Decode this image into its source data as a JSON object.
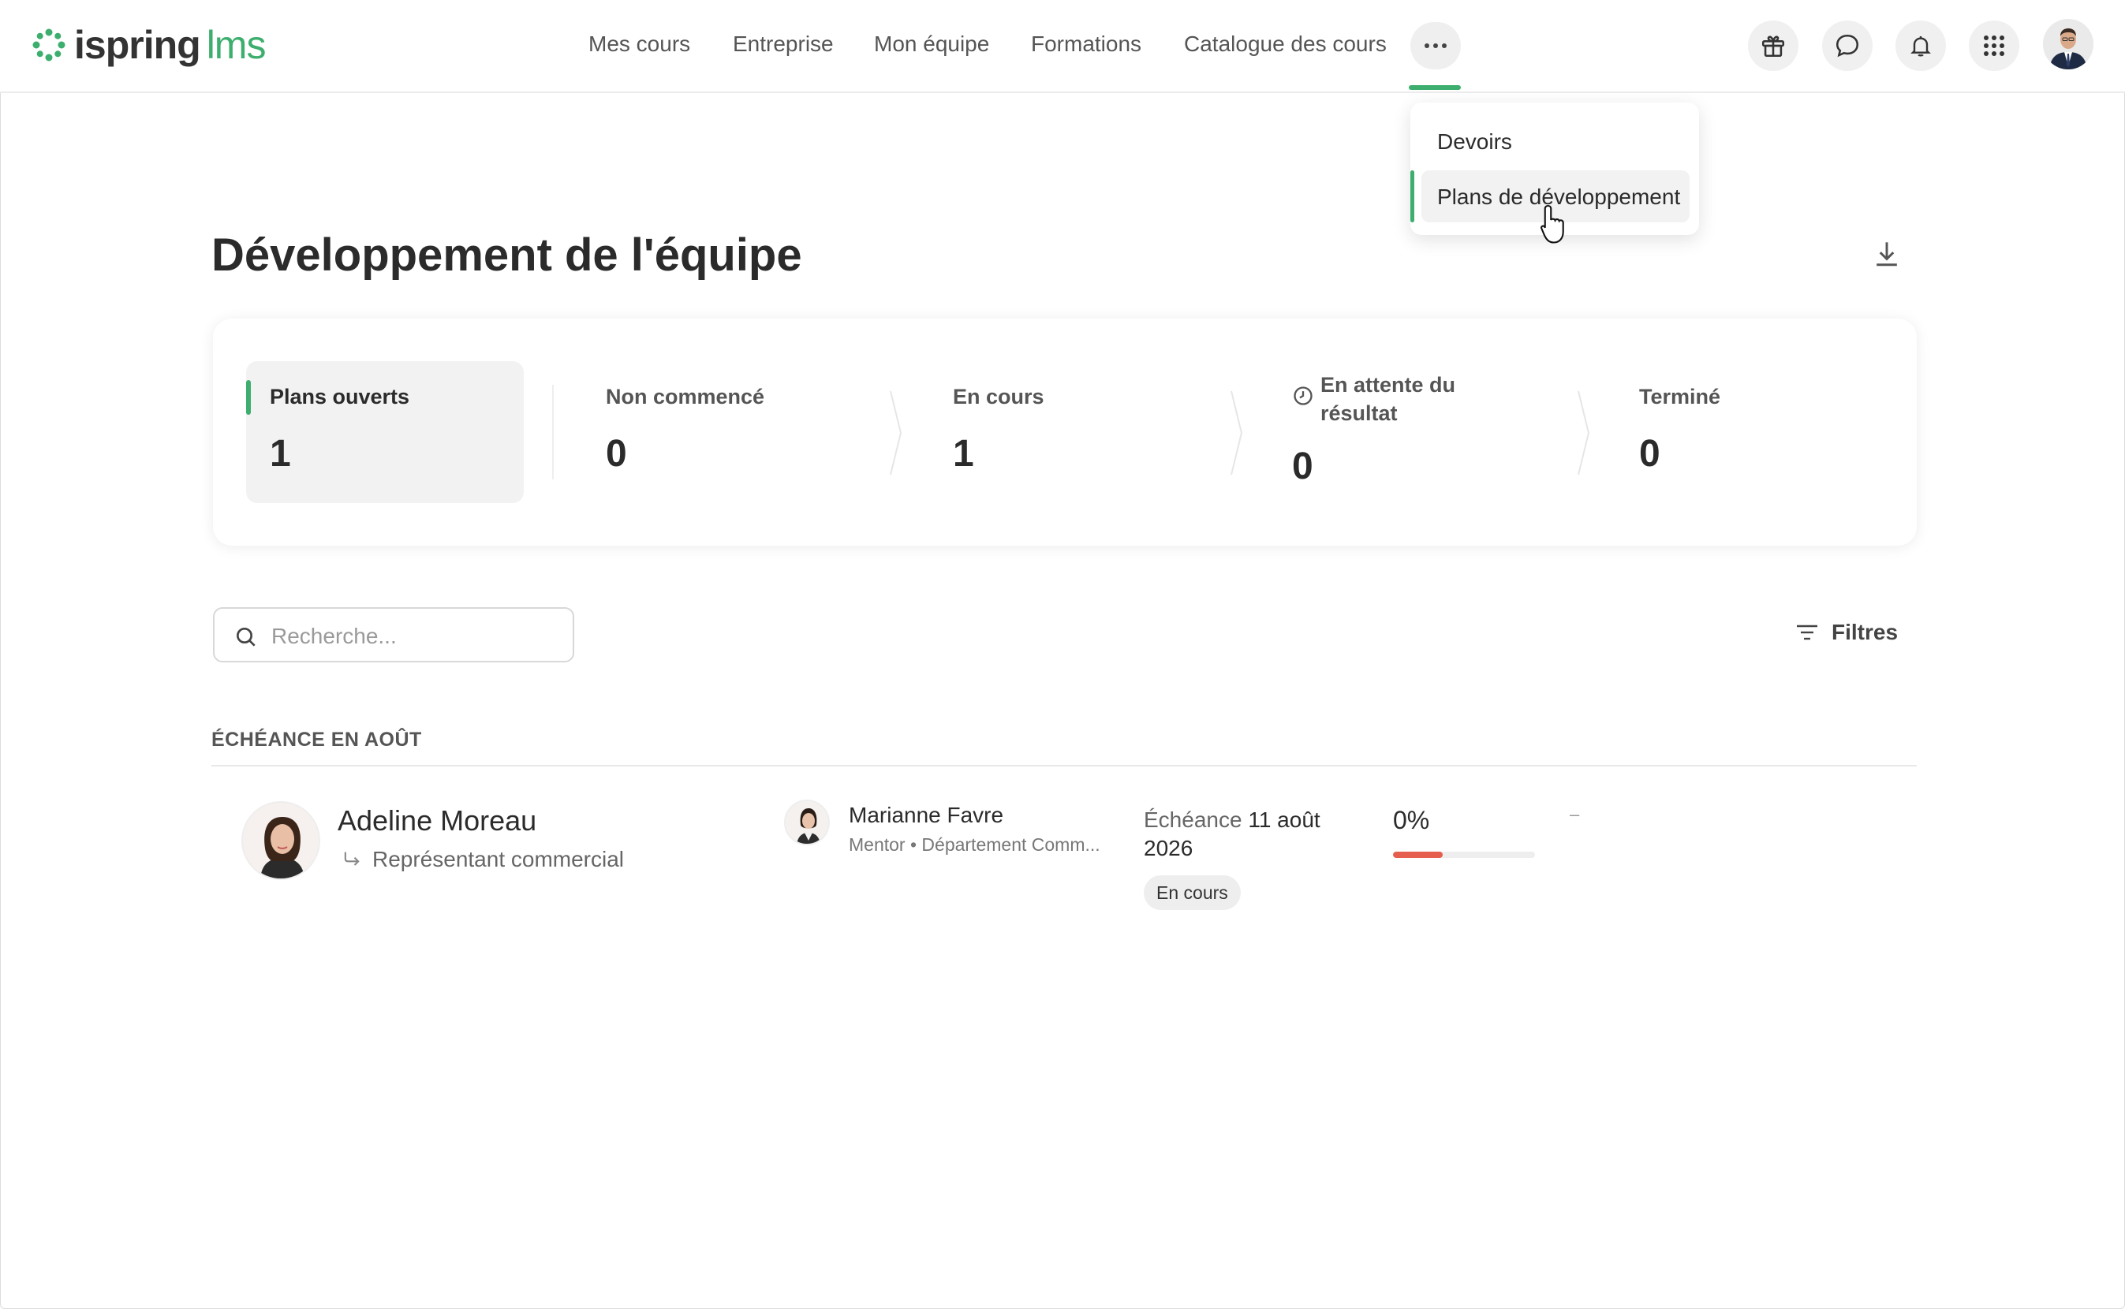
{
  "brand": {
    "name": "ispring",
    "product": "lms",
    "accent_color": "#3dae6e"
  },
  "nav": {
    "items": [
      {
        "label": "Mes cours"
      },
      {
        "label": "Entreprise"
      },
      {
        "label": "Mon équipe"
      },
      {
        "label": "Formations"
      },
      {
        "label": "Catalogue des cours"
      }
    ],
    "more_icon": "more-horizontal-icon"
  },
  "header_icons": [
    "gift-icon",
    "chat-icon",
    "bell-icon",
    "apps-grid-icon",
    "user-avatar"
  ],
  "dropdown": {
    "items": [
      {
        "label": "Devoirs",
        "active": false
      },
      {
        "label": "Plans de développement",
        "active": true
      }
    ]
  },
  "page": {
    "title": "Développement de l'équipe",
    "download_icon": "download-icon"
  },
  "stats": [
    {
      "label": "Plans ouverts",
      "value": "1",
      "active": true
    },
    {
      "label": "Non commencé",
      "value": "0"
    },
    {
      "label": "En cours",
      "value": "1"
    },
    {
      "label": "En attente du résultat",
      "value": "0",
      "icon": "clock-icon"
    },
    {
      "label": "Terminé",
      "value": "0"
    }
  ],
  "search": {
    "placeholder": "Recherche...",
    "value": ""
  },
  "filters": {
    "label": "Filtres"
  },
  "group": {
    "title": "ÉCHÉANCE EN AOÛT"
  },
  "rows": [
    {
      "name": "Adeline Moreau",
      "role": "Représentant commercial",
      "mentor_name": "Marianne Favre",
      "mentor_sub": "Mentor • Département Comm...",
      "due_label": "Échéance",
      "due_date": "11 août 2026",
      "status": "En cours",
      "progress_text": "0%",
      "progress_fraction": 0.35,
      "progress_color": "#e55e4e",
      "extra": "–"
    }
  ]
}
